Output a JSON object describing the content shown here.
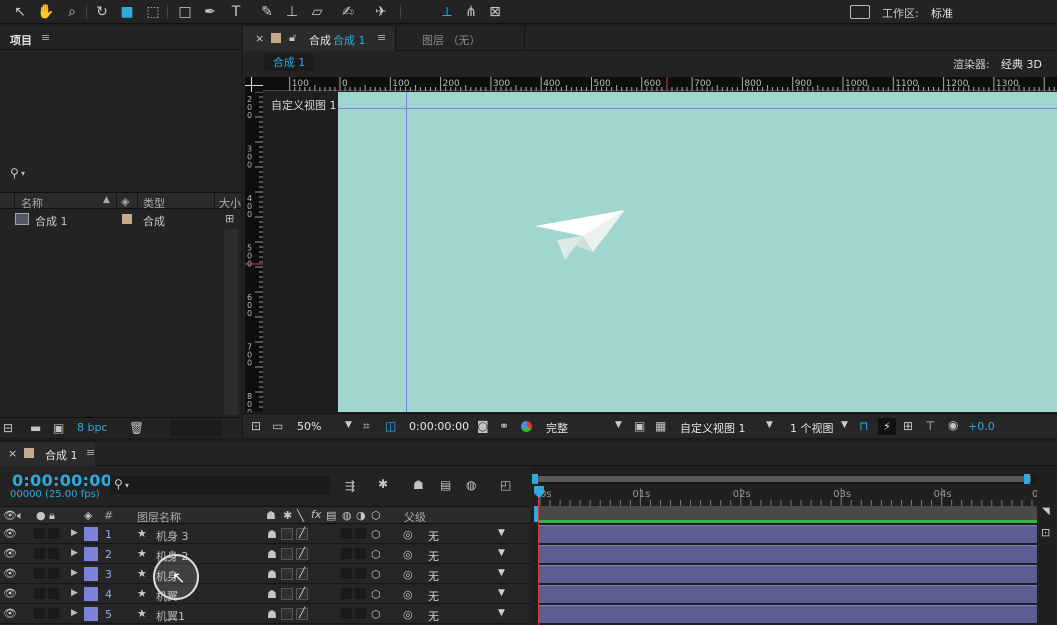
{
  "toolbar": {
    "workspace_label": "工作区:",
    "workspace_value": "标准"
  },
  "project": {
    "title": "项目",
    "menu": "≡",
    "search_placeholder": "",
    "columns": {
      "name": "名称",
      "type": "类型",
      "size": "大小"
    },
    "items": [
      {
        "name": "合成 1",
        "type": "合成"
      }
    ],
    "bpc": "8 bpc"
  },
  "comp": {
    "close": "×",
    "tab_prefix": "合成",
    "tab_name": "合成 1",
    "tab_menu": "≡",
    "layer_tab": "图层 （无）",
    "chip": "合成 1",
    "renderer_label": "渲染器:",
    "renderer_value": "经典 3D",
    "view_label": "自定义视图 1",
    "ruler_h": [
      "100",
      "0",
      "100",
      "200",
      "300",
      "400",
      "500",
      "600",
      "700",
      "800",
      "900",
      "1000",
      "1100",
      "1200",
      "1300"
    ],
    "ruler_v": [
      "2\n0\n0",
      "3\n0\n0",
      "4\n0\n0",
      "5\n0\n0",
      "6\n0\n0",
      "7\n0\n0",
      "8\n0\n0"
    ],
    "zoom": "50%",
    "timecode": "0:00:00:00",
    "resolution": "完整",
    "view": "自定义视图 1",
    "view_count": "1 个视图",
    "exposure": "+0.0",
    "bg_color": "#a0d6cf"
  },
  "timeline": {
    "close": "×",
    "tab_name": "合成 1",
    "tab_menu": "≡",
    "timecode": "0:00:00:00",
    "frames": "00000 (25.00 fps)",
    "headers": {
      "num": "#",
      "name": "图层名称",
      "parent": "父级"
    },
    "ruler": [
      "0s",
      "01s",
      "02s",
      "03s",
      "04s",
      "0"
    ],
    "layers": [
      {
        "num": "1",
        "name": "机身 3",
        "parent": "无"
      },
      {
        "num": "2",
        "name": "机身 2",
        "parent": "无"
      },
      {
        "num": "3",
        "name": "机身",
        "parent": "无"
      },
      {
        "num": "4",
        "name": "机翼",
        "parent": "无"
      },
      {
        "num": "5",
        "name": "机翼1",
        "parent": "无"
      }
    ],
    "label_color": "#7b83d8",
    "bar_color": "#5b5e92",
    "accent": "#2fa9e0"
  }
}
